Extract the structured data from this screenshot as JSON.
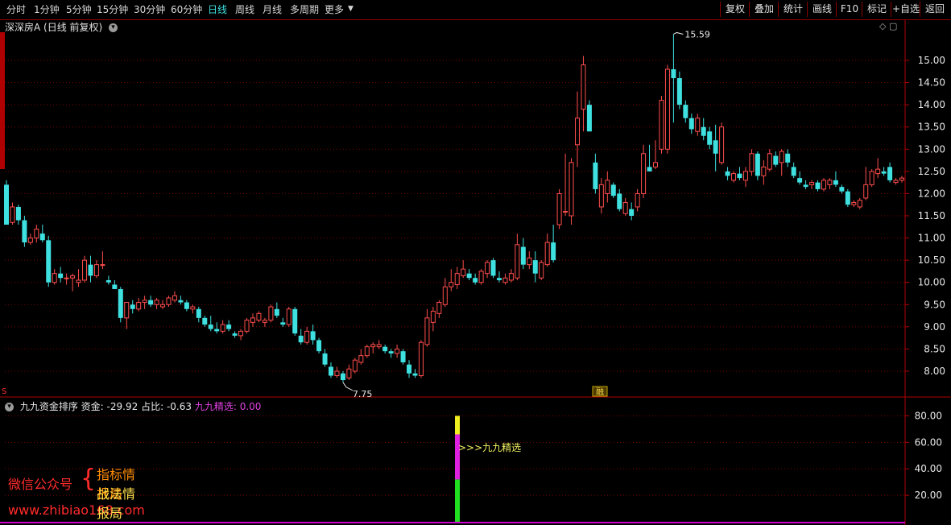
{
  "toolbar": {
    "periods": [
      "分时",
      "1分钟",
      "5分钟",
      "15分钟",
      "30分钟",
      "60分钟",
      "日线",
      "周线",
      "月线",
      "多周期",
      "更多"
    ],
    "active_period": "日线",
    "buttons": [
      "复权",
      "叠加",
      "统计",
      "画线",
      "F10",
      "标记",
      "+自选",
      "返回"
    ]
  },
  "header": {
    "stock_name": "深深房A",
    "period_info": "(日线 前复权)",
    "corner_icons": "◇ ▢"
  },
  "colors": {
    "up": "#ff4d4d",
    "down": "#3ee0e0",
    "grid": "#7a0000",
    "axis": "#b00000",
    "label": "#e8e8e8"
  },
  "main_chart": {
    "y_ticks": [
      "15.00",
      "14.50",
      "14.00",
      "13.50",
      "13.00",
      "12.50",
      "12.00",
      "11.50",
      "11.00",
      "10.50",
      "10.00",
      "9.50",
      "9.00",
      "8.50",
      "8.00"
    ],
    "high_label": "15.59",
    "low_label": "7.75",
    "badge": "融"
  },
  "indicator": {
    "name": "九九资金排序",
    "fund_label": "资金:",
    "fund_value": "-29.92",
    "ratio_label": "占比:",
    "ratio_value": "-0.63",
    "select_label": "九九精选:",
    "select_value": "0.00",
    "y_ticks": [
      "80.00",
      "60.00",
      "40.00",
      "20.00"
    ],
    "signal_text": ">>>九九精选"
  },
  "promo": {
    "wechat": "微信公众号",
    "line1": "指标情报局",
    "line2": "战法情报局",
    "url": "www.zhibiao168.com"
  },
  "chart_data": {
    "type": "candlestick",
    "title": "深深房A",
    "y_range": [
      7.6,
      15.9
    ],
    "candles_ohlc": [
      [
        12.2,
        12.3,
        11.4,
        11.3
      ],
      [
        11.35,
        11.8,
        11.3,
        11.7
      ],
      [
        11.7,
        11.75,
        11.3,
        11.4
      ],
      [
        11.4,
        11.5,
        10.8,
        10.9
      ],
      [
        10.9,
        11.1,
        10.85,
        11.0
      ],
      [
        11.0,
        11.3,
        10.9,
        11.2
      ],
      [
        11.1,
        11.3,
        10.9,
        10.95
      ],
      [
        10.95,
        11.05,
        9.9,
        10.0
      ],
      [
        10.0,
        10.3,
        9.95,
        10.2
      ],
      [
        10.2,
        10.35,
        10.0,
        10.1
      ],
      [
        10.1,
        10.2,
        9.95,
        10.1
      ],
      [
        10.1,
        10.2,
        9.8,
        10.15
      ],
      [
        10.0,
        10.3,
        9.9,
        10.05
      ],
      [
        10.05,
        10.6,
        10.0,
        10.5
      ],
      [
        10.4,
        10.6,
        10.0,
        10.15
      ],
      [
        10.15,
        10.5,
        10.1,
        10.4
      ],
      [
        10.4,
        10.7,
        10.3,
        10.4
      ],
      [
        10.05,
        10.15,
        9.95,
        10.0
      ],
      [
        9.95,
        10.05,
        9.85,
        9.85
      ],
      [
        9.85,
        9.9,
        9.1,
        9.2
      ],
      [
        9.2,
        9.5,
        8.95,
        9.55
      ],
      [
        9.5,
        9.6,
        9.3,
        9.4
      ],
      [
        9.4,
        9.65,
        9.35,
        9.55
      ],
      [
        9.55,
        9.7,
        9.4,
        9.6
      ],
      [
        9.6,
        9.7,
        9.45,
        9.5
      ],
      [
        9.5,
        9.65,
        9.4,
        9.6
      ],
      [
        9.45,
        9.6,
        9.4,
        9.5
      ],
      [
        9.5,
        9.7,
        9.45,
        9.65
      ],
      [
        9.6,
        9.8,
        9.55,
        9.7
      ],
      [
        9.6,
        9.7,
        9.5,
        9.55
      ],
      [
        9.55,
        9.6,
        9.35,
        9.4
      ],
      [
        9.4,
        9.5,
        9.3,
        9.45
      ],
      [
        9.4,
        9.45,
        9.1,
        9.2
      ],
      [
        9.2,
        9.25,
        9.0,
        9.05
      ],
      [
        9.05,
        9.25,
        8.9,
        8.95
      ],
      [
        8.95,
        9.1,
        8.85,
        8.9
      ],
      [
        8.9,
        9.15,
        8.85,
        9.05
      ],
      [
        9.05,
        9.15,
        8.9,
        8.95
      ],
      [
        8.85,
        8.9,
        8.75,
        8.8
      ],
      [
        8.8,
        8.95,
        8.7,
        8.9
      ],
      [
        8.9,
        9.2,
        8.85,
        9.15
      ],
      [
        9.1,
        9.3,
        9.0,
        9.2
      ],
      [
        9.15,
        9.35,
        9.1,
        9.3
      ],
      [
        9.1,
        9.2,
        9.0,
        9.15
      ],
      [
        9.15,
        9.5,
        9.1,
        9.45
      ],
      [
        9.4,
        9.55,
        9.2,
        9.25
      ],
      [
        9.1,
        9.2,
        9.0,
        9.05
      ],
      [
        9.05,
        9.45,
        9.0,
        9.4
      ],
      [
        9.4,
        9.45,
        8.8,
        8.85
      ],
      [
        8.8,
        8.95,
        8.6,
        8.65
      ],
      [
        8.65,
        9.0,
        8.6,
        8.9
      ],
      [
        8.9,
        9.05,
        8.6,
        8.7
      ],
      [
        8.7,
        8.75,
        8.4,
        8.45
      ],
      [
        8.4,
        8.5,
        8.1,
        8.15
      ],
      [
        8.1,
        8.2,
        7.85,
        7.9
      ],
      [
        7.9,
        8.1,
        7.85,
        8.0
      ],
      [
        7.95,
        8.0,
        7.75,
        7.8
      ],
      [
        7.85,
        8.15,
        7.8,
        8.05
      ],
      [
        8.0,
        8.3,
        7.95,
        8.25
      ],
      [
        8.2,
        8.5,
        8.15,
        8.35
      ],
      [
        8.35,
        8.6,
        8.3,
        8.55
      ],
      [
        8.55,
        8.65,
        8.4,
        8.6
      ],
      [
        8.55,
        8.7,
        8.5,
        8.6
      ],
      [
        8.55,
        8.6,
        8.4,
        8.45
      ],
      [
        8.45,
        8.5,
        8.3,
        8.4
      ],
      [
        8.4,
        8.6,
        8.3,
        8.5
      ],
      [
        8.45,
        8.5,
        8.15,
        8.2
      ],
      [
        8.15,
        8.25,
        7.85,
        7.95
      ],
      [
        7.95,
        8.05,
        7.85,
        7.9
      ],
      [
        7.9,
        8.7,
        7.85,
        8.65
      ],
      [
        8.6,
        9.4,
        8.55,
        9.2
      ],
      [
        9.1,
        9.45,
        8.9,
        9.35
      ],
      [
        9.3,
        9.6,
        9.2,
        9.55
      ],
      [
        9.5,
        10.1,
        9.45,
        9.9
      ],
      [
        9.9,
        10.3,
        9.8,
        10.0
      ],
      [
        9.95,
        10.35,
        9.85,
        10.2
      ],
      [
        10.15,
        10.5,
        10.1,
        10.3
      ],
      [
        10.2,
        10.3,
        10.05,
        10.1
      ],
      [
        10.1,
        10.2,
        9.95,
        10.0
      ],
      [
        10.0,
        10.3,
        9.95,
        10.25
      ],
      [
        10.2,
        10.5,
        10.1,
        10.45
      ],
      [
        10.5,
        10.55,
        10.1,
        10.15
      ],
      [
        10.1,
        10.25,
        10.0,
        10.05
      ],
      [
        10.0,
        10.2,
        9.95,
        10.1
      ],
      [
        10.05,
        10.3,
        10.0,
        10.2
      ],
      [
        10.1,
        11.1,
        10.05,
        10.85
      ],
      [
        10.8,
        11.0,
        10.3,
        10.4
      ],
      [
        10.4,
        10.7,
        10.3,
        10.55
      ],
      [
        10.5,
        10.7,
        10.0,
        10.2
      ],
      [
        10.1,
        10.5,
        10.05,
        10.45
      ],
      [
        10.4,
        11.1,
        10.35,
        10.9
      ],
      [
        10.9,
        11.3,
        10.45,
        10.5
      ],
      [
        11.3,
        12.1,
        11.2,
        12.0
      ],
      [
        11.6,
        12.9,
        11.5,
        11.6
      ],
      [
        11.5,
        12.8,
        11.3,
        12.7
      ],
      [
        13.1,
        14.3,
        12.6,
        13.7
      ],
      [
        13.9,
        15.1,
        13.4,
        14.9
      ],
      [
        14.0,
        14.1,
        13.4,
        13.4
      ],
      [
        12.7,
        12.9,
        12.0,
        12.1
      ],
      [
        11.7,
        12.35,
        11.55,
        12.2
      ],
      [
        12.0,
        12.5,
        11.8,
        12.3
      ],
      [
        12.2,
        12.25,
        11.9,
        11.95
      ],
      [
        12.0,
        12.1,
        11.6,
        11.65
      ],
      [
        11.55,
        11.9,
        11.5,
        11.8
      ],
      [
        11.65,
        11.8,
        11.4,
        11.5
      ],
      [
        11.7,
        12.1,
        11.6,
        12.0
      ],
      [
        12.0,
        13.1,
        11.9,
        12.9
      ],
      [
        12.6,
        13.1,
        12.5,
        12.5
      ],
      [
        12.6,
        13.2,
        12.55,
        12.7
      ],
      [
        13.0,
        14.2,
        12.9,
        14.1
      ],
      [
        13.0,
        14.9,
        12.9,
        14.8
      ],
      [
        14.8,
        15.59,
        13.6,
        14.6
      ],
      [
        14.6,
        14.75,
        13.9,
        14.0
      ],
      [
        14.0,
        14.1,
        13.6,
        13.7
      ],
      [
        13.7,
        13.8,
        13.35,
        13.45
      ],
      [
        13.4,
        13.8,
        13.3,
        13.7
      ],
      [
        13.5,
        13.7,
        13.2,
        13.3
      ],
      [
        13.4,
        13.5,
        13.0,
        13.1
      ],
      [
        13.2,
        13.55,
        12.5,
        12.9
      ],
      [
        12.7,
        13.6,
        12.65,
        13.5
      ],
      [
        12.5,
        12.6,
        12.3,
        12.4
      ],
      [
        12.3,
        12.5,
        12.25,
        12.45
      ],
      [
        12.45,
        12.6,
        12.3,
        12.35
      ],
      [
        12.3,
        12.6,
        12.15,
        12.5
      ],
      [
        12.5,
        13.0,
        12.4,
        12.9
      ],
      [
        12.9,
        12.95,
        12.3,
        12.4
      ],
      [
        12.4,
        12.75,
        12.2,
        12.6
      ],
      [
        12.55,
        13.0,
        12.5,
        12.9
      ],
      [
        12.85,
        12.95,
        12.6,
        12.65
      ],
      [
        12.7,
        13.0,
        12.4,
        12.95
      ],
      [
        12.9,
        13.0,
        12.6,
        12.7
      ],
      [
        12.6,
        12.7,
        12.35,
        12.4
      ],
      [
        12.35,
        12.5,
        12.2,
        12.25
      ],
      [
        12.2,
        12.3,
        12.1,
        12.15
      ],
      [
        12.2,
        12.3,
        12.1,
        12.25
      ],
      [
        12.25,
        12.3,
        12.05,
        12.1
      ],
      [
        12.1,
        12.35,
        12.05,
        12.3
      ],
      [
        12.2,
        12.35,
        12.1,
        12.3
      ],
      [
        12.3,
        12.5,
        12.15,
        12.2
      ],
      [
        12.15,
        12.2,
        12.0,
        12.05
      ],
      [
        12.05,
        12.1,
        11.7,
        11.75
      ],
      [
        11.75,
        11.85,
        11.7,
        11.8
      ],
      [
        11.7,
        11.9,
        11.65,
        11.85
      ],
      [
        11.9,
        12.6,
        11.85,
        12.2
      ],
      [
        12.2,
        12.55,
        12.15,
        12.5
      ],
      [
        12.45,
        12.8,
        12.35,
        12.55
      ],
      [
        12.5,
        12.6,
        12.4,
        12.45
      ],
      [
        12.6,
        12.7,
        12.25,
        12.3
      ],
      [
        12.25,
        12.35,
        12.2,
        12.3
      ],
      [
        12.3,
        12.4,
        12.25,
        12.35
      ]
    ],
    "indicator_bar": {
      "segments": [
        {
          "color": "green",
          "from": 0,
          "to": 32
        },
        {
          "color": "magenta",
          "from": 32,
          "to": 66
        },
        {
          "color": "yellow",
          "from": 66,
          "to": 80
        }
      ]
    },
    "indicator_y_range": [
      0,
      90
    ]
  }
}
